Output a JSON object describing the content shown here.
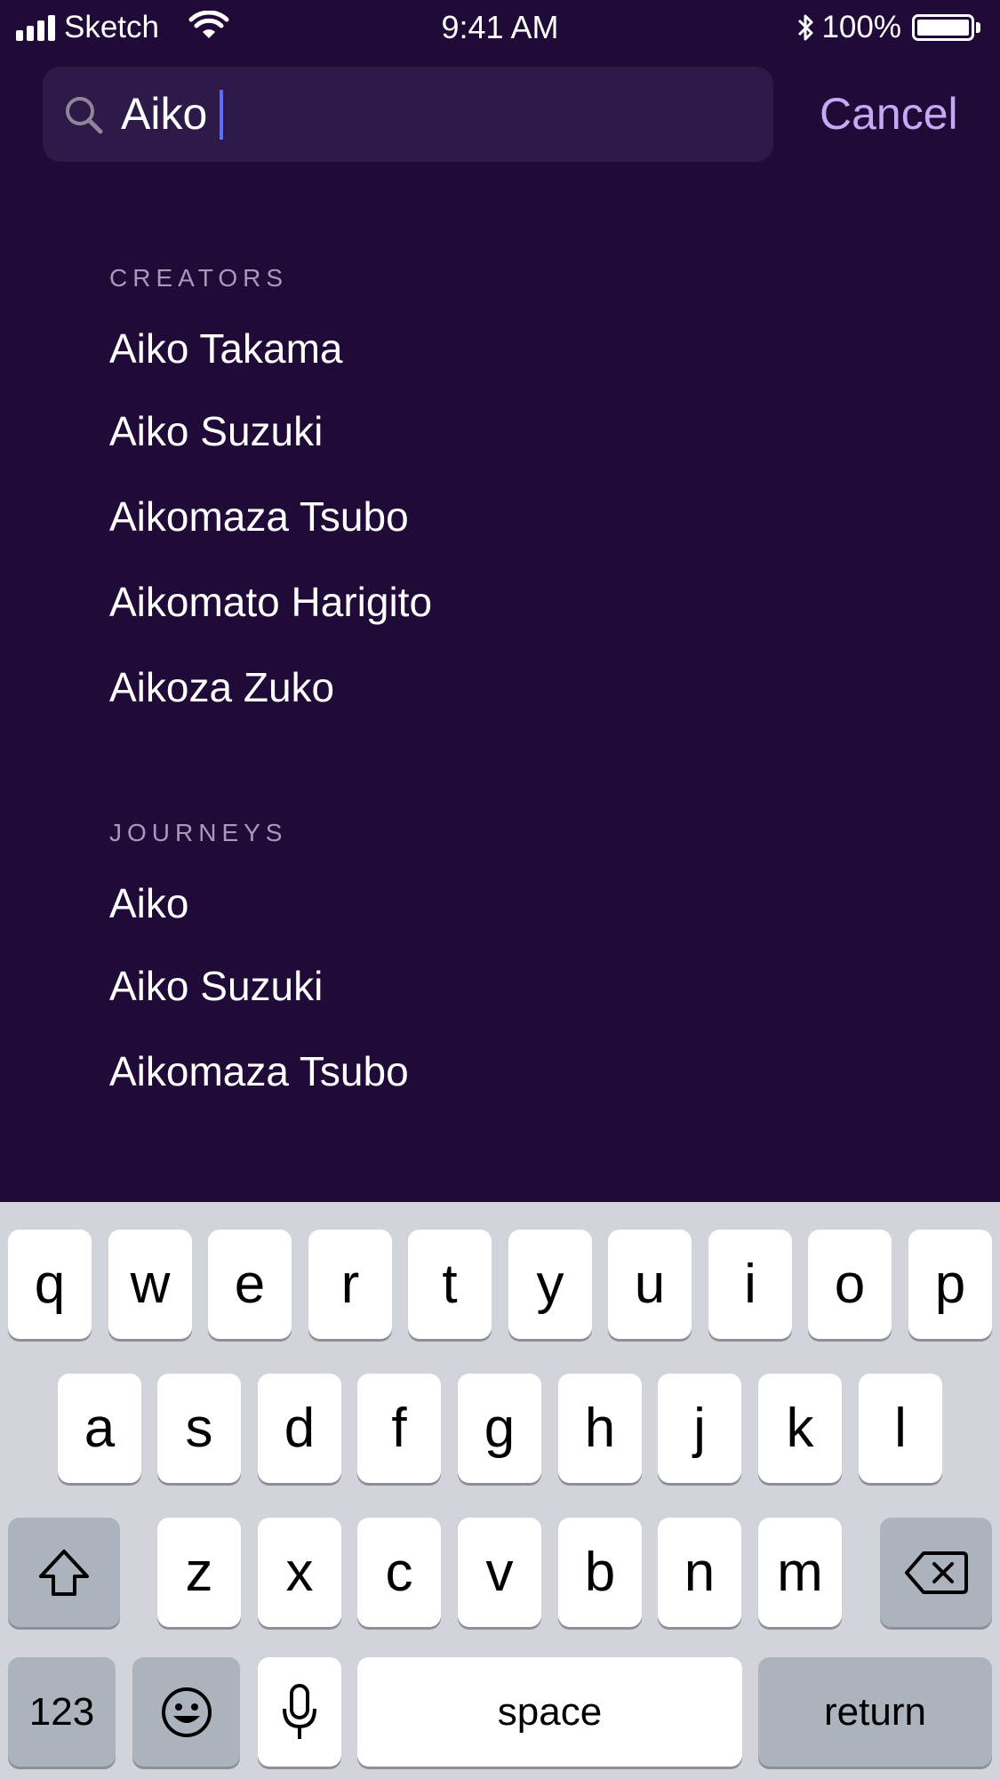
{
  "status_bar": {
    "carrier": "Sketch",
    "time": "9:41 AM",
    "battery_percent": "100%",
    "battery_level": 1.0,
    "icons": [
      "signal-icon",
      "wifi-icon",
      "bluetooth-icon",
      "battery-icon"
    ]
  },
  "search": {
    "value": "Aiko",
    "cancel_label": "Cancel"
  },
  "sections": {
    "creators": {
      "header": "CREATORS",
      "items": [
        "Aiko Takama",
        "Aiko Suzuki",
        "Aikomaza Tsubo",
        "Aikomato Harigito",
        "Aikoza Zuko"
      ]
    },
    "journeys": {
      "header": "JOURNEYS",
      "items": [
        "Aiko",
        "Aiko Suzuki",
        "Aikomaza Tsubo"
      ]
    }
  },
  "keyboard": {
    "row1": [
      "q",
      "w",
      "e",
      "r",
      "t",
      "y",
      "u",
      "i",
      "o",
      "p"
    ],
    "row2": [
      "a",
      "s",
      "d",
      "f",
      "g",
      "h",
      "j",
      "k",
      "l"
    ],
    "row3": [
      "z",
      "x",
      "c",
      "v",
      "b",
      "n",
      "m"
    ],
    "numbers_label": "123",
    "space_label": "space",
    "return_label": "return",
    "icons": [
      "shift-icon",
      "delete-icon",
      "emoji-icon",
      "microphone-icon"
    ]
  },
  "colors": {
    "background": "#200a37",
    "search_field": "#2e1a48",
    "accent": "#c7a8f5",
    "caret": "#5b6cff",
    "section_header": "#a79ab9"
  }
}
